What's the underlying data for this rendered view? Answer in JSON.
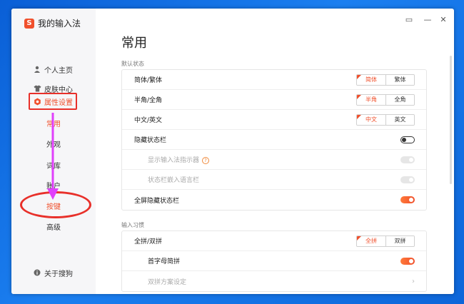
{
  "app": {
    "name": "我的输入法",
    "logo_letter": "S"
  },
  "sidebar": {
    "items": [
      {
        "label": "个人主页",
        "icon": "user-icon"
      },
      {
        "label": "皮肤中心",
        "icon": "shirt-icon"
      },
      {
        "label": "属性设置",
        "icon": "settings-icon"
      }
    ],
    "sub_items": [
      "常用",
      "外观",
      "词库",
      "账户",
      "按键",
      "高级"
    ],
    "about": {
      "label": "关于搜狗",
      "icon": "info-icon"
    }
  },
  "page": {
    "title": "常用",
    "sections": [
      {
        "label": "默认状态",
        "rows": [
          {
            "label": "简体/繁体",
            "options": [
              "简体",
              "繁体"
            ],
            "selected": 0
          },
          {
            "label": "半角/全角",
            "options": [
              "半角",
              "全角"
            ],
            "selected": 0
          },
          {
            "label": "中文/英文",
            "options": [
              "中文",
              "英文"
            ],
            "selected": 0
          },
          {
            "label": "隐藏状态栏",
            "toggle": "off"
          },
          {
            "label": "显示输入法指示器",
            "toggle": "disabled",
            "help": "?"
          },
          {
            "label": "状态栏嵌入语言栏",
            "toggle": "disabled"
          },
          {
            "label": "全屏隐藏状态栏",
            "toggle": "on"
          }
        ]
      },
      {
        "label": "输入习惯",
        "rows": [
          {
            "label": "全拼/双拼",
            "options": [
              "全拼",
              "双拼"
            ],
            "selected": 0
          },
          {
            "label": "首字母简拼",
            "toggle": "on"
          },
          {
            "label": "双拼方案设定",
            "chevron": "›"
          }
        ]
      }
    ]
  },
  "window_controls": {
    "feedback": "▭",
    "minimize": "—",
    "close": "✕"
  },
  "colors": {
    "accent": "#f0502c",
    "highlight": "#e8302a",
    "arrow": "#e040fb"
  }
}
